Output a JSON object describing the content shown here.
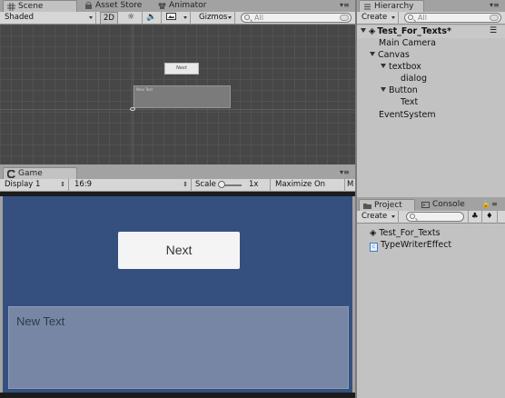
{
  "scene_panel": {
    "tabs": [
      {
        "label": "Scene",
        "icon": "grid-icon"
      },
      {
        "label": "Asset Store",
        "icon": "store-icon"
      },
      {
        "label": "Animator",
        "icon": "animator-icon"
      }
    ],
    "toolbar": {
      "shading": "Shaded",
      "mode_2d": "2D",
      "gizmos": "Gizmos",
      "search_placeholder": "All"
    },
    "scene_button_text": "Next",
    "scene_box_text": "New Text"
  },
  "game_panel": {
    "tab": "Game",
    "toolbar": {
      "display": "Display 1",
      "aspect": "16:9",
      "scale_label": "Scale",
      "scale_value": "1x",
      "maximize": "Maximize On Play",
      "mute_initial": "M"
    },
    "next_button": "Next",
    "dialog_text": "New Text",
    "colors": {
      "background": "#35507f",
      "button": "#f4f4f4",
      "dialog": "#7886a6"
    }
  },
  "hierarchy": {
    "tab": "Hierarchy",
    "create": "Create",
    "search_placeholder": "All",
    "scene_name": "Test_For_Texts*",
    "items": [
      {
        "label": "Main Camera",
        "depth": 1,
        "expanded": null
      },
      {
        "label": "Canvas",
        "depth": 1,
        "expanded": true
      },
      {
        "label": "textbox",
        "depth": 2,
        "expanded": true
      },
      {
        "label": "dialog",
        "depth": 3,
        "expanded": null
      },
      {
        "label": "Button",
        "depth": 2,
        "expanded": true
      },
      {
        "label": "Text",
        "depth": 3,
        "expanded": null
      },
      {
        "label": "EventSystem",
        "depth": 1,
        "expanded": null
      }
    ]
  },
  "project": {
    "tabs": [
      {
        "label": "Project",
        "icon": "folder-icon"
      },
      {
        "label": "Console",
        "icon": "console-icon"
      }
    ],
    "create": "Create",
    "items": [
      {
        "label": "Test_For_Texts",
        "icon": "unity-scene-icon"
      },
      {
        "label": "TypeWriterEffect",
        "icon": "csharp-script-icon"
      }
    ]
  }
}
